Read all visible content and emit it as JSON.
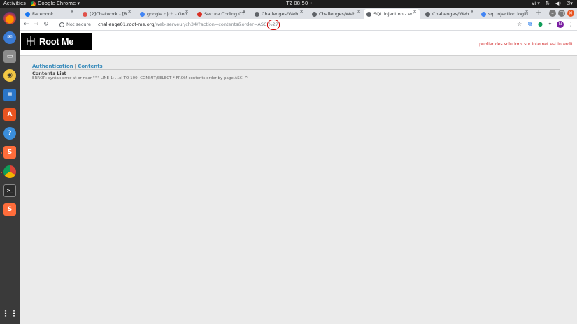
{
  "topbar": {
    "activities": "Activities",
    "app_name": "Google Chrome ▾",
    "clock": "T2 08:50 •",
    "lang": "vi ▾"
  },
  "dock": {
    "apps": [
      "firefox-icon",
      "thunderbird-icon",
      "files-icon",
      "rhythmbox-icon",
      "writer-icon",
      "software-icon",
      "help-icon",
      "sublime-icon",
      "chrome-icon",
      "terminal-icon",
      "sublime-icon",
      "apps-grid-icon"
    ]
  },
  "tabs": [
    {
      "label": "Facebook",
      "color": "#1877f2"
    },
    {
      "label": "[2]Chatwork - [R...",
      "color": "#e0524b"
    },
    {
      "label": "google d|ch - Goo...",
      "color": "#4285f4"
    },
    {
      "label": "Secure Coding CT...",
      "color": "#d93025"
    },
    {
      "label": "Challenges/Web...",
      "color": "#5f6368"
    },
    {
      "label": "Challenges/Web...",
      "color": "#5f6368"
    },
    {
      "label": "SQL injection - err...",
      "color": "#5f6368"
    },
    {
      "label": "Challenges/Web...",
      "color": "#5f6368"
    },
    {
      "label": "sql injection login...",
      "color": "#4285f4"
    }
  ],
  "omnibox": {
    "security": "Not secure",
    "host": "challenge01.root-me.org",
    "path": "/web-serveur/ch34/?action=contents&order=ASC",
    "highlight": "%27"
  },
  "page": {
    "logo_text": "Root Me",
    "banner": "publier des solutions sur internet est interdit",
    "menu": {
      "auth": "Authentication",
      "sep": "|",
      "contents": "Contents"
    },
    "section_title": "Contents List",
    "error": "ERROR: syntax error at or near \"'\"\" LINE 1: ...ol TO 100; COMMIT;SELECT * FROM contents order by page ASC' ^"
  },
  "profile_initial": "N"
}
